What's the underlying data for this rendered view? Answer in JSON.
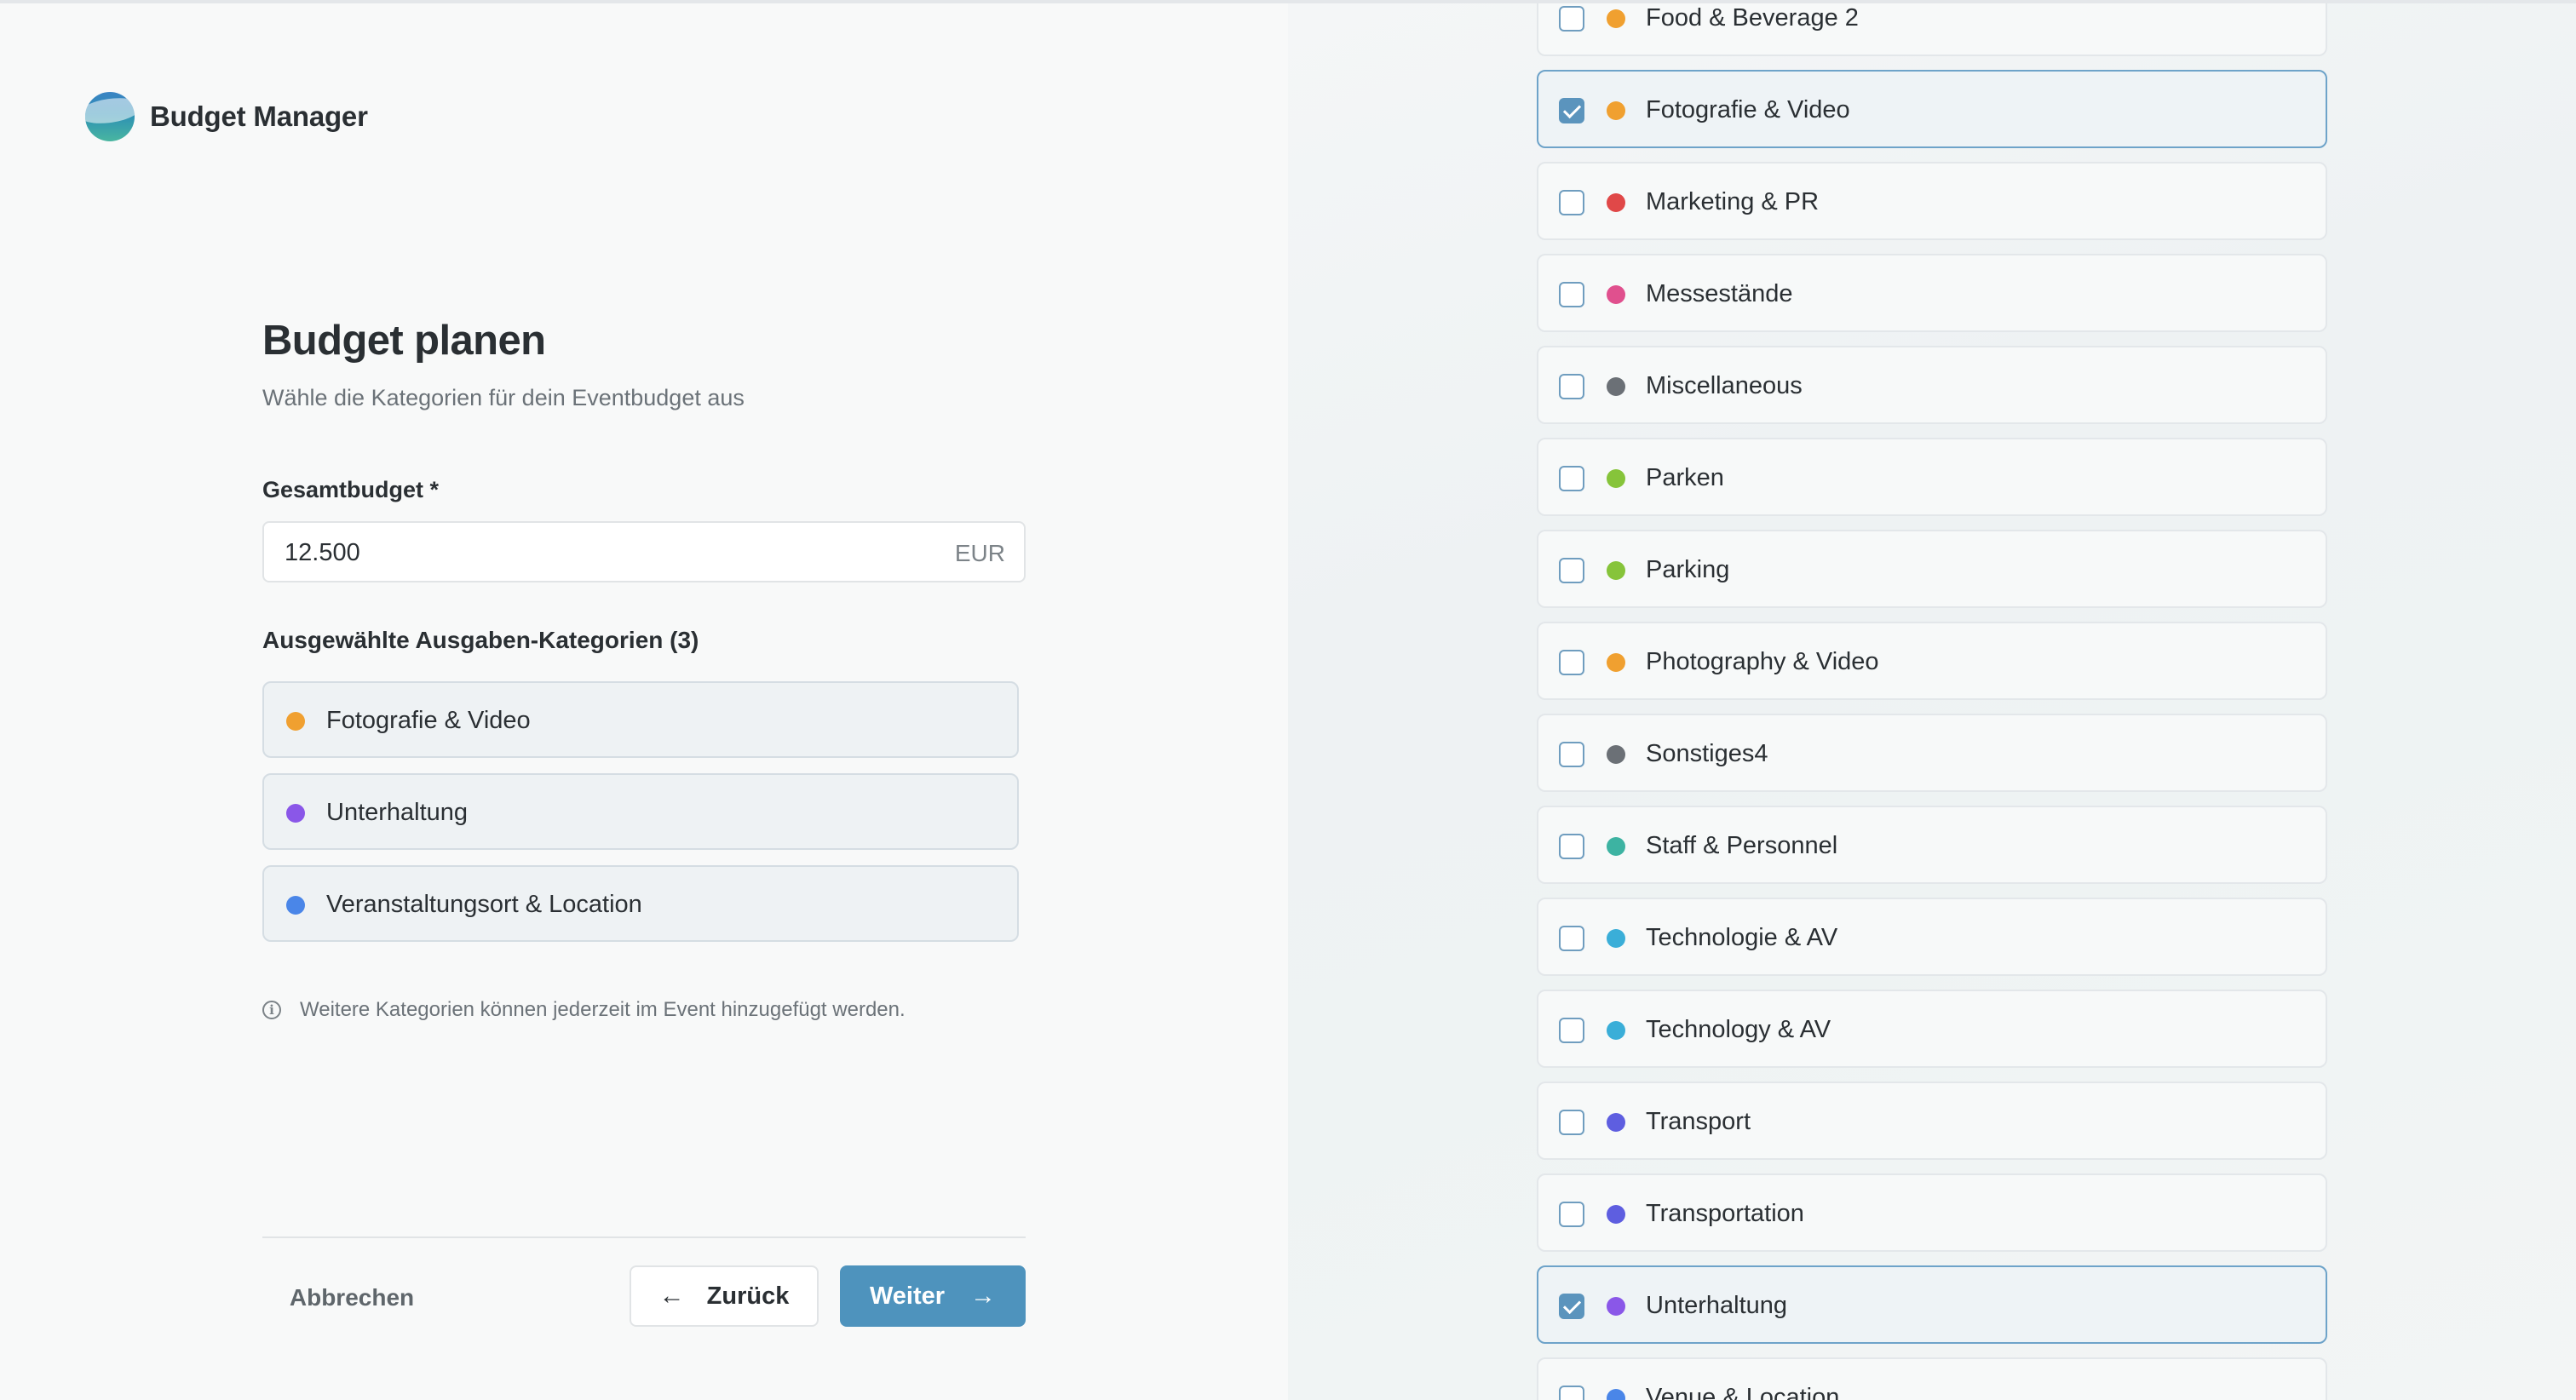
{
  "app": {
    "name": "Budget Manager"
  },
  "form": {
    "title": "Budget planen",
    "subtitle": "Wähle die Kategorien für dein Eventbudget aus",
    "budget_label": "Gesamtbudget *",
    "budget_value": "12.500",
    "budget_currency": "EUR",
    "selected_label": "Ausgewählte Ausgaben-Kategorien (3)",
    "selected": [
      {
        "label": "Fotografie & Video",
        "color": "#f0a030"
      },
      {
        "label": "Unterhaltung",
        "color": "#8a57e8"
      },
      {
        "label": "Veranstaltungsort & Location",
        "color": "#4a86e8"
      }
    ],
    "hint": "Weitere Kategorien können jederzeit im Event hinzugefügt werden.",
    "hint_icon": "i",
    "cancel_label": "Abbrechen",
    "back_label": "Zurück",
    "back_arrow": "←",
    "next_label": "Weiter",
    "next_arrow": "→"
  },
  "categories": [
    {
      "label": "Food & Beverage 2",
      "color": "#f0a030",
      "checked": false
    },
    {
      "label": "Fotografie & Video",
      "color": "#f0a030",
      "checked": true
    },
    {
      "label": "Marketing & PR",
      "color": "#e04848",
      "checked": false
    },
    {
      "label": "Messestände",
      "color": "#e0508e",
      "checked": false
    },
    {
      "label": "Miscellaneous",
      "color": "#6b7076",
      "checked": false
    },
    {
      "label": "Parken",
      "color": "#86c43a",
      "checked": false
    },
    {
      "label": "Parking",
      "color": "#86c43a",
      "checked": false
    },
    {
      "label": "Photography & Video",
      "color": "#f0a030",
      "checked": false
    },
    {
      "label": "Sonstiges4",
      "color": "#6b7076",
      "checked": false
    },
    {
      "label": "Staff & Personnel",
      "color": "#3db3a2",
      "checked": false
    },
    {
      "label": "Technologie & AV",
      "color": "#3aaed8",
      "checked": false
    },
    {
      "label": "Technology & AV",
      "color": "#3aaed8",
      "checked": false
    },
    {
      "label": "Transport",
      "color": "#5e5ee0",
      "checked": false
    },
    {
      "label": "Transportation",
      "color": "#5e5ee0",
      "checked": false
    },
    {
      "label": "Unterhaltung",
      "color": "#8a57e8",
      "checked": true
    },
    {
      "label": "Venue & Location",
      "color": "#4a86e8",
      "checked": false
    }
  ]
}
